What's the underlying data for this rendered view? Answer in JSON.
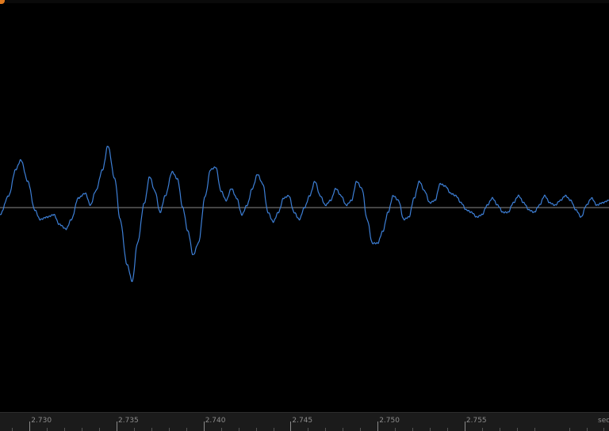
{
  "colors": {
    "background": "#000000",
    "waveform": "#3d7fd6",
    "baseline": "#8a8a8a",
    "ruler_background": "#1b1b1b",
    "ruler_text": "#8c8c8c",
    "accent": "#e07a1f"
  },
  "ruler": {
    "ticks": [
      "2.730",
      "2.735",
      "2.740",
      "2.745",
      "2.750",
      "2.755"
    ],
    "unit_label": "sec"
  },
  "waveform": {
    "start_time": 2.7283,
    "end_time": 2.7633,
    "amplitude_range": [
      -1,
      1
    ],
    "samples": [
      [
        2.7283,
        -0.06
      ],
      [
        2.7288,
        0.1
      ],
      [
        2.7292,
        0.32
      ],
      [
        2.7295,
        0.4
      ],
      [
        2.7299,
        0.22
      ],
      [
        2.7303,
        -0.02
      ],
      [
        2.7306,
        -0.1
      ],
      [
        2.731,
        -0.08
      ],
      [
        2.7314,
        -0.06
      ],
      [
        2.7317,
        -0.14
      ],
      [
        2.7321,
        -0.18
      ],
      [
        2.7324,
        -0.1
      ],
      [
        2.7328,
        0.08
      ],
      [
        2.7332,
        0.12
      ],
      [
        2.7335,
        0.02
      ],
      [
        2.7338,
        0.14
      ],
      [
        2.7342,
        0.32
      ],
      [
        2.7345,
        0.52
      ],
      [
        2.7349,
        0.24
      ],
      [
        2.7352,
        -0.1
      ],
      [
        2.7356,
        -0.48
      ],
      [
        2.7359,
        -0.62
      ],
      [
        2.7362,
        -0.3
      ],
      [
        2.7366,
        0.04
      ],
      [
        2.7369,
        0.26
      ],
      [
        2.7372,
        0.14
      ],
      [
        2.7375,
        -0.04
      ],
      [
        2.7378,
        0.1
      ],
      [
        2.7382,
        0.3
      ],
      [
        2.7385,
        0.24
      ],
      [
        2.7388,
        0.0
      ],
      [
        2.7391,
        -0.2
      ],
      [
        2.7394,
        -0.4
      ],
      [
        2.7397,
        -0.3
      ],
      [
        2.7401,
        0.1
      ],
      [
        2.7404,
        0.32
      ],
      [
        2.7407,
        0.34
      ],
      [
        2.741,
        0.14
      ],
      [
        2.7413,
        0.06
      ],
      [
        2.7416,
        0.16
      ],
      [
        2.7419,
        0.08
      ],
      [
        2.7422,
        -0.06
      ],
      [
        2.7425,
        0.02
      ],
      [
        2.7428,
        0.16
      ],
      [
        2.7431,
        0.28
      ],
      [
        2.7434,
        0.2
      ],
      [
        2.7437,
        -0.04
      ],
      [
        2.744,
        -0.12
      ],
      [
        2.7443,
        -0.04
      ],
      [
        2.7446,
        0.08
      ],
      [
        2.7449,
        0.1
      ],
      [
        2.7452,
        -0.04
      ],
      [
        2.7455,
        -0.1
      ],
      [
        2.7458,
        0.0
      ],
      [
        2.7461,
        0.1
      ],
      [
        2.7464,
        0.22
      ],
      [
        2.7467,
        0.1
      ],
      [
        2.747,
        0.02
      ],
      [
        2.7473,
        0.06
      ],
      [
        2.7476,
        0.16
      ],
      [
        2.7479,
        0.1
      ],
      [
        2.7482,
        0.02
      ],
      [
        2.7485,
        0.06
      ],
      [
        2.7488,
        0.22
      ],
      [
        2.7491,
        0.16
      ],
      [
        2.7494,
        -0.1
      ],
      [
        2.7497,
        -0.3
      ],
      [
        2.75,
        -0.3
      ],
      [
        2.7503,
        -0.2
      ],
      [
        2.7506,
        -0.04
      ],
      [
        2.7509,
        0.1
      ],
      [
        2.7512,
        0.06
      ],
      [
        2.7515,
        -0.1
      ],
      [
        2.7518,
        -0.08
      ],
      [
        2.7521,
        0.08
      ],
      [
        2.7524,
        0.22
      ],
      [
        2.7527,
        0.14
      ],
      [
        2.753,
        0.04
      ],
      [
        2.7533,
        0.06
      ],
      [
        2.7536,
        0.2
      ],
      [
        2.7539,
        0.18
      ],
      [
        2.7542,
        0.12
      ],
      [
        2.7545,
        0.1
      ],
      [
        2.7548,
        0.04
      ],
      [
        2.7551,
        -0.02
      ],
      [
        2.7554,
        -0.04
      ],
      [
        2.7557,
        -0.08
      ],
      [
        2.756,
        -0.06
      ],
      [
        2.7563,
        0.02
      ],
      [
        2.7566,
        0.08
      ],
      [
        2.7569,
        0.02
      ],
      [
        2.7572,
        -0.04
      ],
      [
        2.7575,
        -0.04
      ],
      [
        2.7578,
        0.04
      ],
      [
        2.7581,
        0.1
      ],
      [
        2.7584,
        0.04
      ],
      [
        2.7587,
        -0.02
      ],
      [
        2.759,
        -0.04
      ],
      [
        2.7593,
        0.02
      ],
      [
        2.7596,
        0.1
      ],
      [
        2.7599,
        0.04
      ],
      [
        2.7602,
        0.02
      ],
      [
        2.7605,
        0.06
      ],
      [
        2.7608,
        0.1
      ],
      [
        2.7611,
        0.06
      ],
      [
        2.7614,
        -0.02
      ],
      [
        2.7617,
        -0.08
      ],
      [
        2.762,
        0.02
      ],
      [
        2.7623,
        0.08
      ],
      [
        2.7626,
        0.02
      ],
      [
        2.7629,
        0.04
      ],
      [
        2.7633,
        0.06
      ]
    ]
  }
}
